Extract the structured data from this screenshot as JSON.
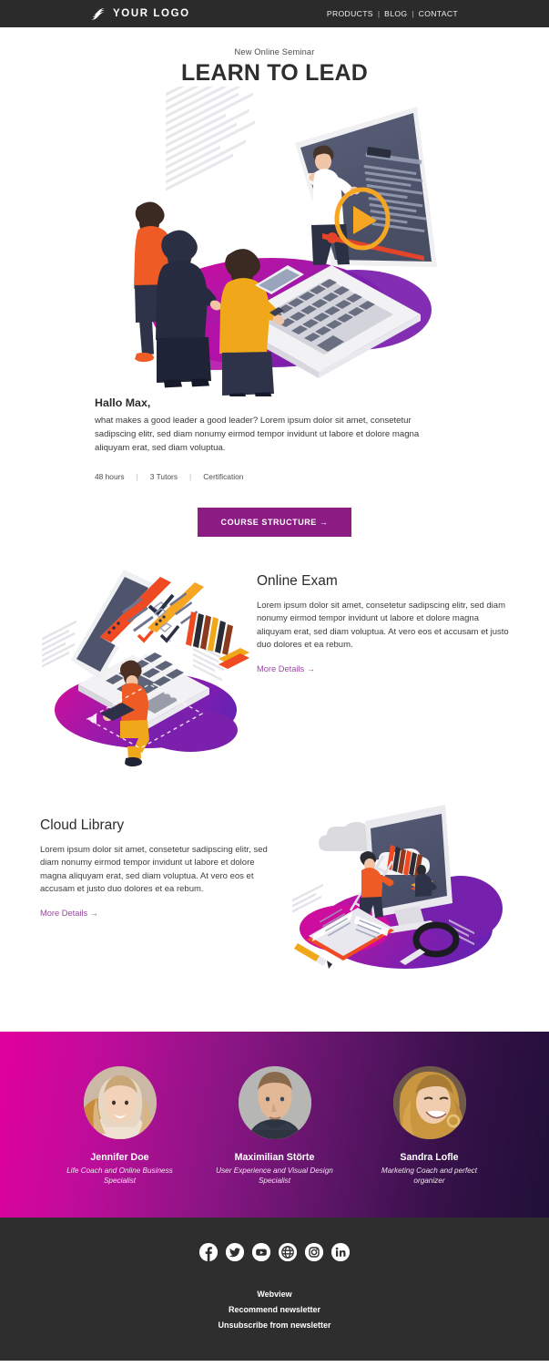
{
  "header": {
    "logo_text": "YOUR LOGO",
    "logo_icon": "swoosh-logo-icon",
    "nav": [
      {
        "label": "PRODUCTS"
      },
      {
        "label": "BLOG"
      },
      {
        "label": "CONTACT"
      }
    ],
    "nav_separator": "|"
  },
  "hero": {
    "kicker": "New Online Seminar",
    "title": "LEARN TO LEAD",
    "illustration": "isometric-laptop-webinar-three-people"
  },
  "intro": {
    "greeting": "Hallo Max,",
    "paragraph": "what makes a good leader a good leader? Lorem ipsum dolor sit amet, consetetur sadipscing elitr, sed diam nonumy eirmod tempor invidunt ut labore et dolore magna aliquyam erat, sed diam voluptua.",
    "meta": [
      "48 hours",
      "3 Tutors",
      "Certification"
    ],
    "meta_separator": "|"
  },
  "cta": {
    "label": "COURSE STRUCTURE →",
    "color": "#8c1b84"
  },
  "features": [
    {
      "title": "Online Exam",
      "body": "Lorem ipsum dolor sit amet, consetetur sadipscing elitr, sed diam nonumy eirmod tempor invidunt ut labore et dolore magna aliquyam erat, sed diam voluptua. At vero eos et accusam et justo duo dolores et ea rebum.",
      "link": "More Details →",
      "illustration": "isometric-laptop-checklist-exam"
    },
    {
      "title": "Cloud Library",
      "body": "Lorem ipsum dolor sit amet, consetetur sadipscing elitr, sed diam nonumy eirmod tempor invidunt ut labore et dolore magna aliquyam erat, sed diam voluptua. At vero eos et accusam et justo duo dolores et ea rebum.",
      "link": "More Details →",
      "illustration": "isometric-monitor-cloud-bookshelf"
    }
  ],
  "team": {
    "gradient_from": "#e1009b",
    "gradient_to": "#201038",
    "members": [
      {
        "name": "Jennifer Doe",
        "role": "Life Coach and Online Business Specialist",
        "avatar": "portrait-woman-blonde"
      },
      {
        "name": "Maximilian Störte",
        "role": "User Experience and Visual Design Specialist",
        "avatar": "portrait-man-short-hair"
      },
      {
        "name": "Sandra Lofle",
        "role": "Marketing Coach and perfect organizer",
        "avatar": "portrait-woman-laughing"
      }
    ]
  },
  "footer": {
    "socials": [
      {
        "name": "facebook-icon"
      },
      {
        "name": "twitter-icon"
      },
      {
        "name": "youtube-icon"
      },
      {
        "name": "website-globe-icon"
      },
      {
        "name": "instagram-icon"
      },
      {
        "name": "linkedin-icon"
      }
    ],
    "links": [
      {
        "label": "Webview"
      },
      {
        "label": "Recommend newsletter"
      },
      {
        "label": "Unsubscribe from newsletter"
      }
    ]
  }
}
